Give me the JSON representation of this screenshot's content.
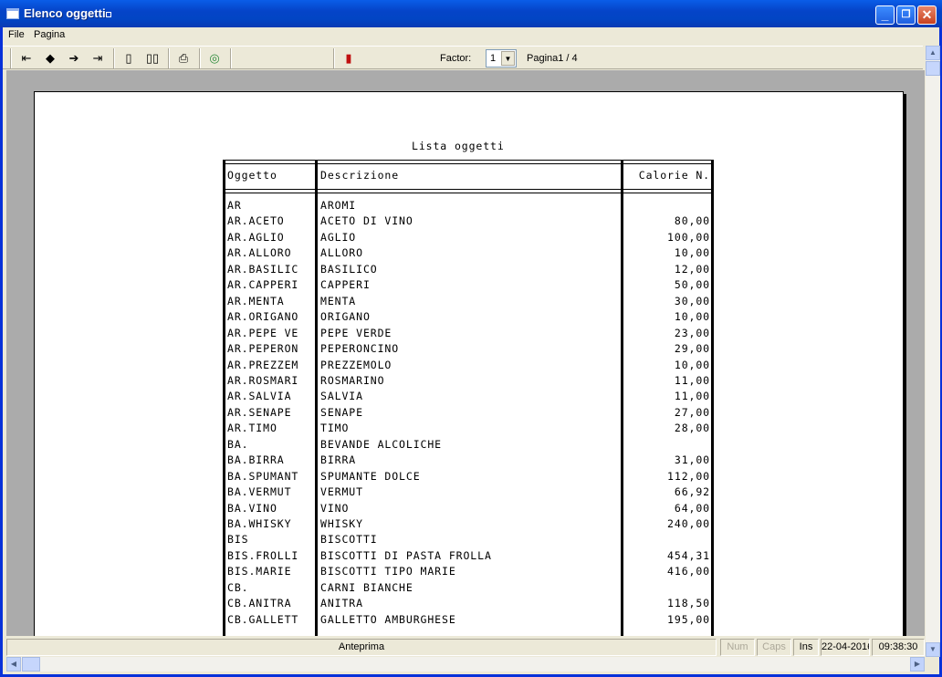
{
  "window": {
    "title": "Elenco oggetti"
  },
  "menu": {
    "items": [
      "File",
      "Pagina"
    ]
  },
  "toolbar": {
    "factor_label": "Factor:",
    "factor_value": "1",
    "page_label": "Pagina1 / 4",
    "icons": [
      "first-page-icon",
      "prev-page-icon",
      "next-page-icon",
      "last-page-icon",
      "single-page-icon",
      "two-page-icon",
      "print-icon",
      "export-icon",
      "exit-door-icon"
    ]
  },
  "report": {
    "title": "Lista oggetti",
    "columns": [
      "Oggetto",
      "Descrizione",
      "Calorie N."
    ],
    "rows": [
      [
        "AR",
        "AROMI",
        ""
      ],
      [
        "AR.ACETO",
        "ACETO DI VINO",
        "80,00"
      ],
      [
        "AR.AGLIO",
        "AGLIO",
        "100,00"
      ],
      [
        "AR.ALLORO",
        "ALLORO",
        "10,00"
      ],
      [
        "AR.BASILIC",
        "BASILICO",
        "12,00"
      ],
      [
        "AR.CAPPERI",
        "CAPPERI",
        "50,00"
      ],
      [
        "AR.MENTA",
        "MENTA",
        "30,00"
      ],
      [
        "AR.ORIGANO",
        "ORIGANO",
        "10,00"
      ],
      [
        "AR.PEPE VE",
        "PEPE VERDE",
        "23,00"
      ],
      [
        "AR.PEPERON",
        "PEPERONCINO",
        "29,00"
      ],
      [
        "AR.PREZZEM",
        "PREZZEMOLO",
        "10,00"
      ],
      [
        "AR.ROSMARI",
        "ROSMARINO",
        "11,00"
      ],
      [
        "AR.SALVIA",
        "SALVIA",
        "11,00"
      ],
      [
        "AR.SENAPE",
        "SENAPE",
        "27,00"
      ],
      [
        "AR.TIMO",
        "TIMO",
        "28,00"
      ],
      [
        "BA.",
        "BEVANDE ALCOLICHE",
        ""
      ],
      [
        "BA.BIRRA",
        "BIRRA",
        "31,00"
      ],
      [
        "BA.SPUMANT",
        "SPUMANTE DOLCE",
        "112,00"
      ],
      [
        "BA.VERMUT",
        "VERMUT",
        "66,92"
      ],
      [
        "BA.VINO",
        "VINO",
        "64,00"
      ],
      [
        "BA.WHISKY",
        "WHISKY",
        "240,00"
      ],
      [
        "BIS",
        "BISCOTTI",
        ""
      ],
      [
        "BIS.FROLLI",
        "BISCOTTI DI PASTA FROLLA",
        "454,31"
      ],
      [
        "BIS.MARIE",
        "BISCOTTI TIPO MARIE",
        "416,00"
      ],
      [
        "CB.",
        "CARNI BIANCHE",
        ""
      ],
      [
        "CB.ANITRA",
        "ANITRA",
        "118,50"
      ],
      [
        "CB.GALLETT",
        "GALLETTO AMBURGHESE",
        "195,00"
      ]
    ]
  },
  "status": {
    "mode": "Anteprima",
    "num": "Num",
    "caps": "Caps",
    "ins": "Ins",
    "date": "22-04-2016",
    "time": "09:38:30"
  }
}
